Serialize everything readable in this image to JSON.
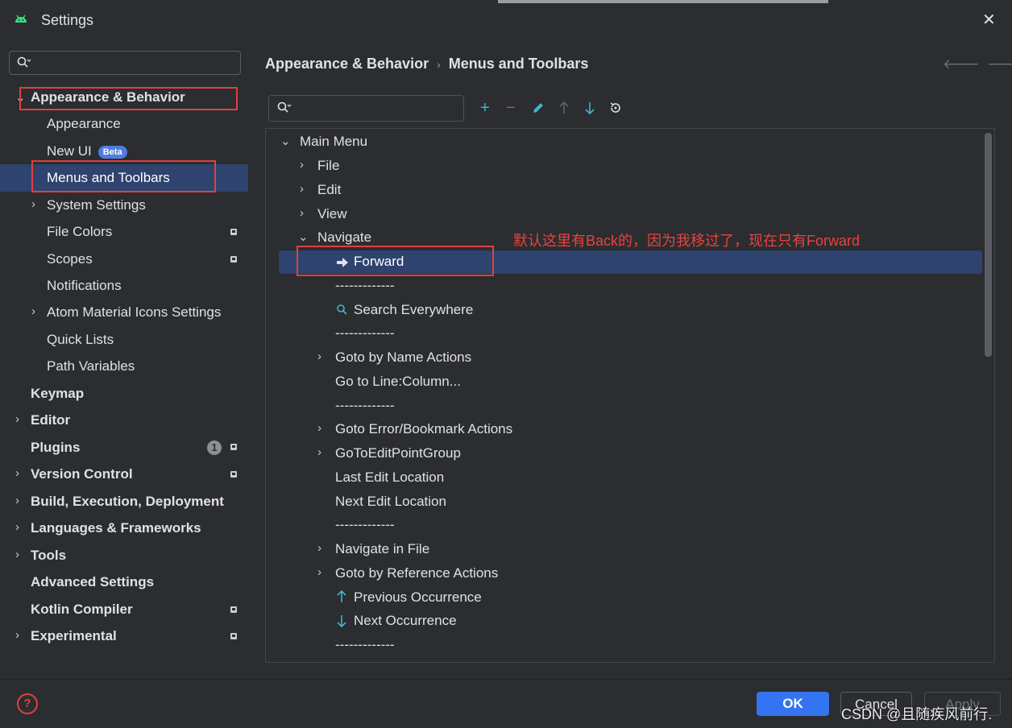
{
  "window": {
    "title": "Settings",
    "close_glyph": "✕"
  },
  "left": {
    "search_placeholder": "",
    "items": [
      {
        "label": "Appearance & Behavior"
      },
      {
        "label": "Appearance"
      },
      {
        "label": "New UI",
        "badge": "Beta"
      },
      {
        "label": "Menus and Toolbars"
      },
      {
        "label": "System Settings"
      },
      {
        "label": "File Colors"
      },
      {
        "label": "Scopes"
      },
      {
        "label": "Notifications"
      },
      {
        "label": "Atom Material Icons Settings"
      },
      {
        "label": "Quick Lists"
      },
      {
        "label": "Path Variables"
      },
      {
        "label": "Keymap"
      },
      {
        "label": "Editor"
      },
      {
        "label": "Plugins",
        "count": "1"
      },
      {
        "label": "Version Control"
      },
      {
        "label": "Build, Execution, Deployment"
      },
      {
        "label": "Languages & Frameworks"
      },
      {
        "label": "Tools"
      },
      {
        "label": "Advanced Settings"
      },
      {
        "label": "Kotlin Compiler"
      },
      {
        "label": "Experimental"
      }
    ]
  },
  "breadcrumb": {
    "parent": "Appearance & Behavior",
    "current": "Menus and Toolbars"
  },
  "toolbar": {
    "search_placeholder": ""
  },
  "tree": {
    "items": [
      "Main Menu",
      "File",
      "Edit",
      "View",
      "Navigate",
      "Forward",
      "-------------",
      "Search Everywhere",
      "-------------",
      "Goto by Name Actions",
      "Go to Line:Column...",
      "-------------",
      "Goto Error/Bookmark Actions",
      "GoToEditPointGroup",
      "Last Edit Location",
      "Next Edit Location",
      "-------------",
      "Navigate in File",
      "Goto by Reference Actions",
      "Previous Occurrence",
      "Next Occurrence",
      "-------------"
    ]
  },
  "annotation": "默认这里有Back的，因为我移过了，现在只有Forward",
  "buttons": {
    "ok": "OK",
    "cancel": "Cancel",
    "apply": "Apply"
  },
  "watermark": "CSDN @且随疾风前行.",
  "colors": {
    "accent": "#3574f0",
    "selection": "#2e436e",
    "highlight_box": "#e0403f",
    "annotation": "#e8423f"
  }
}
